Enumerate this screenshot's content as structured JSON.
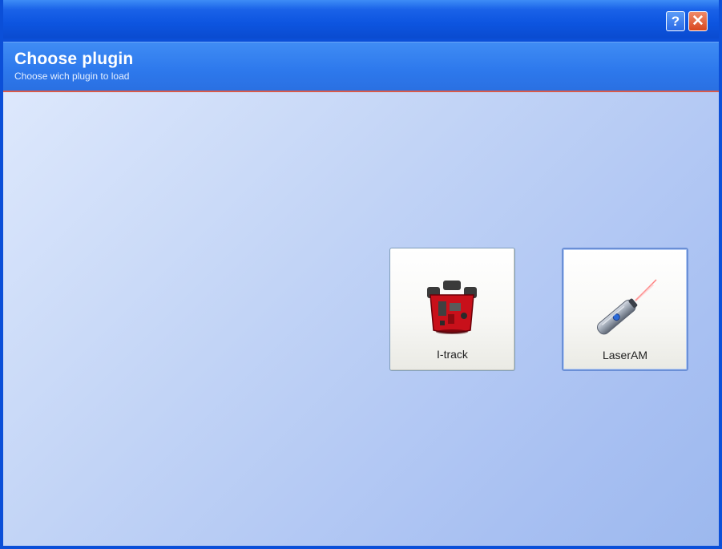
{
  "titlebar": {
    "help_icon": "question-mark-icon",
    "close_icon": "close-x-icon",
    "help_glyph": "?",
    "close_glyph": "✕"
  },
  "header": {
    "title": "Choose plugin",
    "subtitle": "Choose wich plugin to load"
  },
  "plugins": [
    {
      "label": "I-track",
      "icon": "red-tracker-device-icon"
    },
    {
      "label": "LaserAM",
      "icon": "laser-pointer-icon"
    }
  ],
  "colors": {
    "titlebar_blue": "#0b4fd8",
    "header_blue": "#2d78ec",
    "header_underline": "#d85a4a",
    "close_red": "#d8471e"
  }
}
